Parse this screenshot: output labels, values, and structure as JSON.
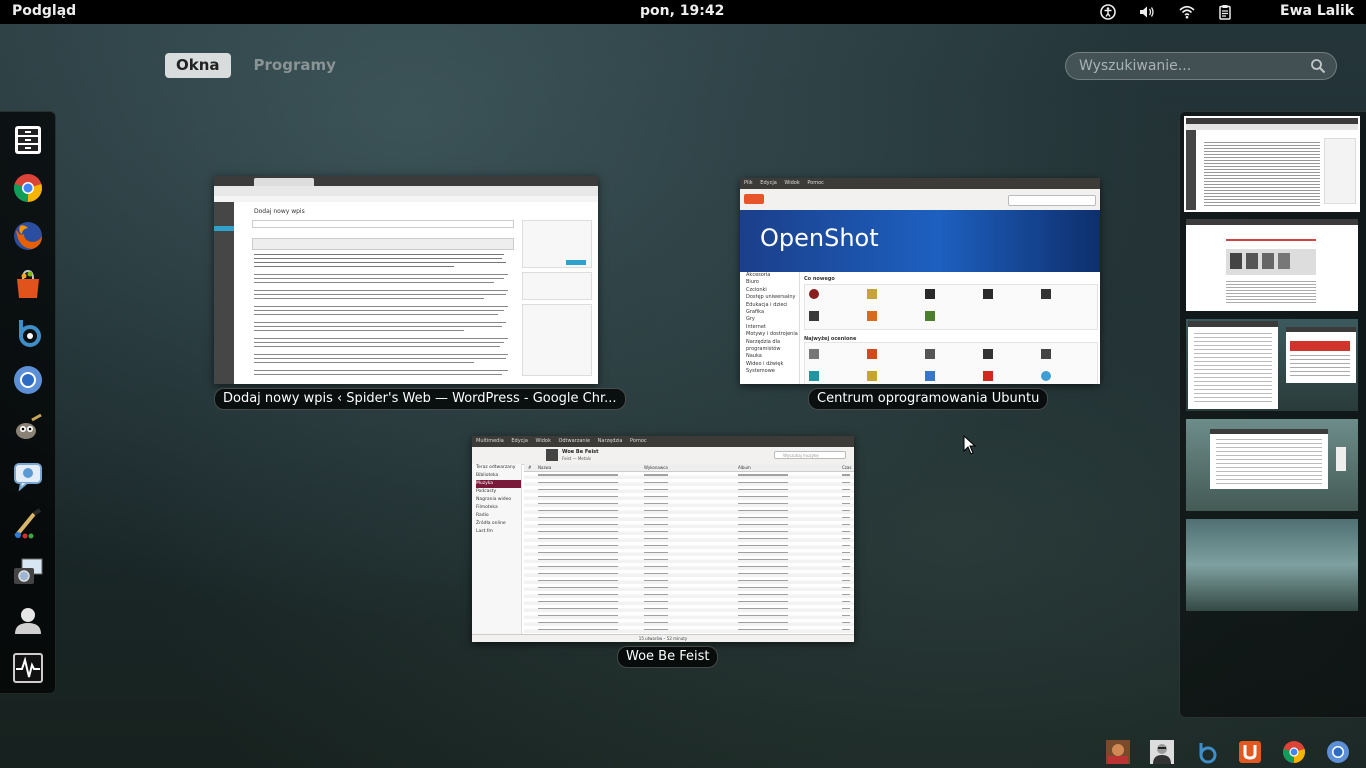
{
  "topbar": {
    "activities": "Podgląd",
    "clock": "pon, 19:42",
    "user": "Ewa Lalik",
    "icons": [
      "accessibility-icon",
      "volume-icon",
      "network-icon",
      "clipboard-icon"
    ]
  },
  "view_tabs": {
    "windows": "Okna",
    "applications": "Programy",
    "selected": "Okna"
  },
  "search": {
    "placeholder": "Wyszukiwanie..."
  },
  "dash": {
    "items": [
      {
        "name": "Pliki",
        "icon": "files-icon"
      },
      {
        "name": "Google Chrome",
        "icon": "chrome-icon"
      },
      {
        "name": "Firefox",
        "icon": "firefox-icon"
      },
      {
        "name": "Centrum oprogramowania Ubuntu",
        "icon": "software-center-icon"
      },
      {
        "name": "Banshee",
        "icon": "banshee-icon"
      },
      {
        "name": "Chromium",
        "icon": "chromium-icon"
      },
      {
        "name": "GIMP",
        "icon": "gimp-icon"
      },
      {
        "name": "Empathy",
        "icon": "chat-icon"
      },
      {
        "name": "MyPaint",
        "icon": "paint-icon"
      },
      {
        "name": "Shotwell",
        "icon": "photos-icon"
      },
      {
        "name": "Konta",
        "icon": "user-icon"
      },
      {
        "name": "Monitor systemu",
        "icon": "system-monitor-icon"
      }
    ]
  },
  "windows": [
    {
      "title": "Dodaj nowy wpis ‹ Spider's Web — WordPress - Google Chr...",
      "page_heading": "Dodaj nowy wpis"
    },
    {
      "title": "Centrum oprogramowania Ubuntu",
      "menu": [
        "Plik",
        "Edycja",
        "Widok",
        "Pomoc"
      ],
      "banner": "OpenShot",
      "section_new": "Co nowego",
      "section_top": "Najwyżej ocenione",
      "categories": [
        "Akcesoria",
        "Biuro",
        "Czcionki",
        "Dostęp uniwersalny",
        "Edukacja i dzieci",
        "Grafika",
        "Gry",
        "Internet",
        "Motywy i dostrojenia",
        "Narzędzia dla programistów",
        "Nauka",
        "Wideo i dźwięk",
        "Systemowe"
      ]
    },
    {
      "title": "Woe Be Feist",
      "menu": [
        "Multimedia",
        "Edycja",
        "Widok",
        "Odtwarzanie",
        "Narzędzia",
        "Pomoc"
      ],
      "now_playing": "Woe Be Feist",
      "album_artist": "Feist — Metals",
      "search_placeholder": "Wyszukaj muzykę",
      "columns": [
        "#",
        "Nazwa",
        "Wykonawca",
        "Album",
        "Czas"
      ],
      "sidebar": [
        "Teraz odtwarzany",
        "Biblioteka",
        "Muzyka",
        "Podcasty",
        "Nagrania wideo",
        "Filmoteka",
        "Radio",
        "Źródła online",
        "Last.fm"
      ],
      "status": "15 utworów – 52 minuty"
    }
  ],
  "workspaces": 5,
  "message_tray": [
    "avatar-1-icon",
    "avatar-2-icon",
    "banshee-icon",
    "ubuntu-one-icon",
    "chrome-icon",
    "chromium-icon"
  ]
}
